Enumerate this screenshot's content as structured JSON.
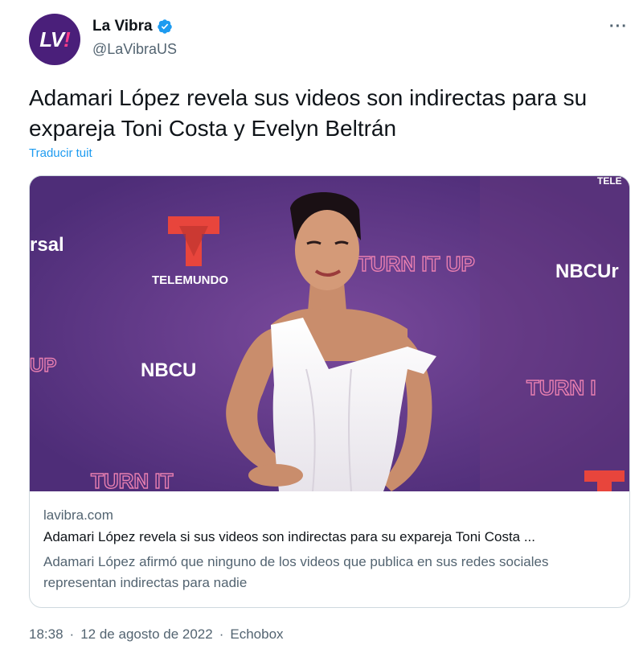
{
  "account": {
    "avatar_text_main": "LV",
    "avatar_text_accent": "!",
    "display_name": "La Vibra",
    "handle": "@LaVibraUS"
  },
  "tweet": {
    "text": "Adamari López revela sus videos son indirectas para su expareja Toni Costa y Evelyn Beltrán",
    "translate_label": "Traducir tuit",
    "more_label": "···"
  },
  "card": {
    "domain": "lavibra.com",
    "title": "Adamari López revela si sus videos son indirectas para su expareja Toni Costa ...",
    "description": "Adamari López afirmó que ninguno de los videos que publica en sus redes sociales representan indirectas para nadie",
    "backdrop_texts": {
      "telemundo": "TELEMUNDO",
      "turn_it_up": "TURN IT UP",
      "nbcu": "NBCUr",
      "nbcu2": "NBCU",
      "rsal": "rsal",
      "turn_right": "TURN I",
      "turn_bottom": "TURN IT",
      "tele_top": "TELE",
      "up_left": "UP"
    }
  },
  "footer": {
    "time": "18:38",
    "sep1": "·",
    "date": "12 de agosto de 2022",
    "sep2": "·",
    "source": "Echobox"
  },
  "colors": {
    "accent": "#1d9bf0",
    "avatar_bg": "#4a1f7a",
    "text_secondary": "#536471"
  }
}
